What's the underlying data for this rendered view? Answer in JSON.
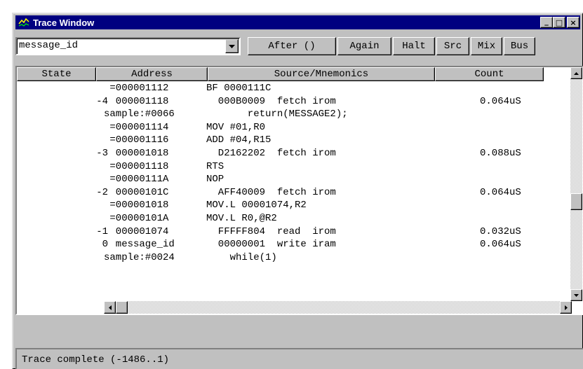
{
  "window": {
    "title": "Trace Window",
    "minimize_glyph": "_",
    "maximize_glyph": "□",
    "close_glyph": "×"
  },
  "toolbar": {
    "filter_value": "message_id",
    "buttons": [
      "After ()",
      "Again",
      "Halt",
      "Src",
      "Mix",
      "Bus"
    ]
  },
  "table": {
    "headers": [
      "State",
      "Address",
      "Source/Mnemonics",
      "Count"
    ],
    "rows": [
      {
        "state": "",
        "address": " =000001112",
        "source": "BF 0000111C",
        "count": ""
      },
      {
        "state": "-4",
        "address": "  000001118",
        "source": "  000B0009  fetch irom",
        "count": "0.064uS"
      },
      {
        "state": "",
        "address": "sample:#0066",
        "source": "       return(MESSAGE2);",
        "count": ""
      },
      {
        "state": "",
        "address": " =000001114",
        "source": "MOV #01,R0",
        "count": ""
      },
      {
        "state": "",
        "address": " =000001116",
        "source": "ADD #04,R15",
        "count": ""
      },
      {
        "state": "-3",
        "address": "  000001018",
        "source": "  D2162202  fetch irom",
        "count": "0.088uS"
      },
      {
        "state": "",
        "address": " =000001118",
        "source": "RTS",
        "count": ""
      },
      {
        "state": "",
        "address": " =00000111A",
        "source": "NOP",
        "count": ""
      },
      {
        "state": "-2",
        "address": "  00000101C",
        "source": "  AFF40009  fetch irom",
        "count": "0.064uS"
      },
      {
        "state": "",
        "address": " =000001018",
        "source": "MOV.L 00001074,R2",
        "count": ""
      },
      {
        "state": "",
        "address": " =00000101A",
        "source": "MOV.L R0,@R2",
        "count": ""
      },
      {
        "state": "-1",
        "address": "  000001074",
        "source": "  FFFFF804  read  irom",
        "count": "0.032uS"
      },
      {
        "state": "0",
        "address": "  message_id",
        "source": "  00000001  write iram",
        "count": "0.064uS"
      },
      {
        "state": "",
        "address": "sample:#0024",
        "source": "    while(1)",
        "count": ""
      }
    ]
  },
  "status": {
    "text": "Trace complete (-1486..1)"
  },
  "colors": {
    "titlebar": "#000080",
    "face": "#c0c0c0"
  }
}
